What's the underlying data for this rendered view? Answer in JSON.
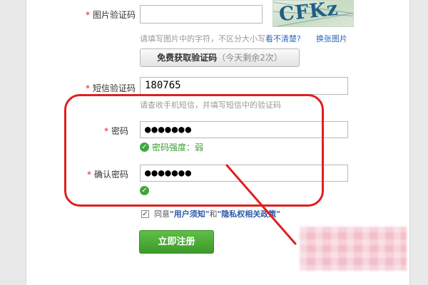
{
  "form": {
    "captcha": {
      "required": "*",
      "label": "图片验证码",
      "value": "",
      "image_text": "CFKz",
      "hint": "请填写图片中的字符，不区分大小写",
      "unclear_link": "看不清楚?",
      "change_link": "换张图片"
    },
    "sms_button": {
      "label": "免费获取验证码",
      "remaining": "（今天剩余2次）"
    },
    "sms": {
      "required": "*",
      "label": "短信验证码",
      "value": "180765",
      "hint": "请查收手机短信，并填写短信中的验证码"
    },
    "password": {
      "required": "*",
      "label": "密码",
      "value": "●●●●●●●",
      "strength_text": "密码强度：弱"
    },
    "confirm_password": {
      "required": "*",
      "label": "确认密码",
      "value": "●●●●●●●"
    },
    "agreement": {
      "prefix": "同意",
      "terms": "\"用户须知\"",
      "and": "和",
      "privacy": "\"隐私权相关政策\""
    },
    "submit_label": "立即注册"
  },
  "colors": {
    "required_star": "#e02020",
    "link": "#2e64b8",
    "success": "#3fa63c",
    "submit_green": "#4aa935",
    "annotation_red": "#e01f1f"
  },
  "icons": {
    "success": "check-circle-icon",
    "checkbox": "checkbox-checked-icon"
  }
}
